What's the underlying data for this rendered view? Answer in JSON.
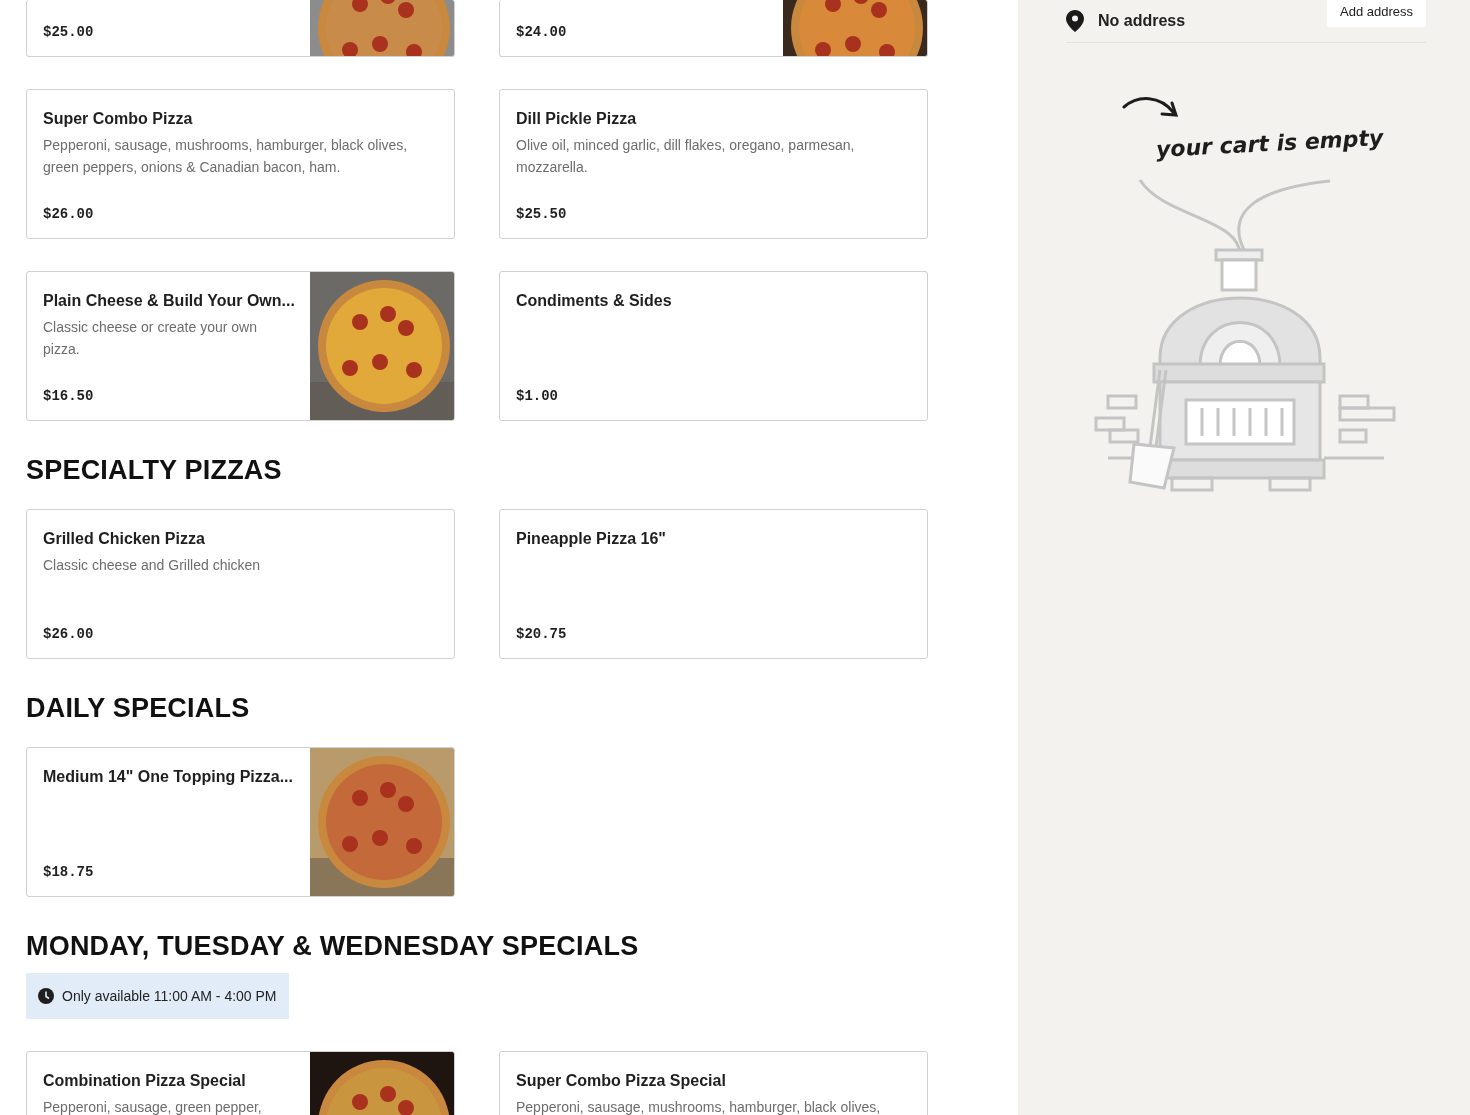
{
  "menu": {
    "sections": [
      {
        "items": [
          {
            "price": "$25.00",
            "kind": "picture"
          },
          {
            "price": "$24.00",
            "kind": "picture"
          }
        ],
        "partial": true
      },
      {
        "items": [
          {
            "name": "Super Combo Pizza",
            "description": "Pepperoni, sausage, mushrooms, hamburger, black olives, green peppers, onions & Canadian bacon, ham.",
            "price": "$26.00",
            "kind": "text"
          },
          {
            "name": "Dill Pickle Pizza",
            "description": "Olive oil, minced garlic, dill flakes, oregano, parmesan, mozzarella.",
            "price": "$25.50",
            "kind": "text"
          },
          {
            "name": "Plain Cheese & Build Your Own...",
            "description": "Classic cheese or create your own pizza.",
            "price": "$16.50",
            "kind": "picture"
          },
          {
            "name": "Condiments & Sides",
            "price": "$1.00",
            "kind": "text"
          }
        ]
      },
      {
        "title": "SPECIALTY PIZZAS",
        "items": [
          {
            "name": "Grilled Chicken Pizza",
            "description": "Classic cheese and Grilled chicken",
            "price": "$26.00",
            "kind": "text"
          },
          {
            "name": "Pineapple Pizza 16\"",
            "price": "$20.75",
            "kind": "text"
          }
        ]
      },
      {
        "title": "DAILY SPECIALS",
        "items": [
          {
            "name": "Medium 14\" One Topping Pizza...",
            "price": "$18.75",
            "kind": "picture"
          }
        ]
      },
      {
        "title": "MONDAY, TUESDAY & WEDNESDAY SPECIALS",
        "notice": "Only available 11:00 AM - 4:00 PM",
        "items": [
          {
            "name": "Combination Pizza Special",
            "description": "Pepperoni, sausage, green pepper,",
            "kind": "picture"
          },
          {
            "name": "Super Combo Pizza Special",
            "description": "Pepperoni, sausage, mushrooms, hamburger, black olives,",
            "kind": "text"
          }
        ]
      }
    ]
  },
  "cart": {
    "address": "No address",
    "address_button": "Add address",
    "empty_message": "your cart is empty"
  }
}
